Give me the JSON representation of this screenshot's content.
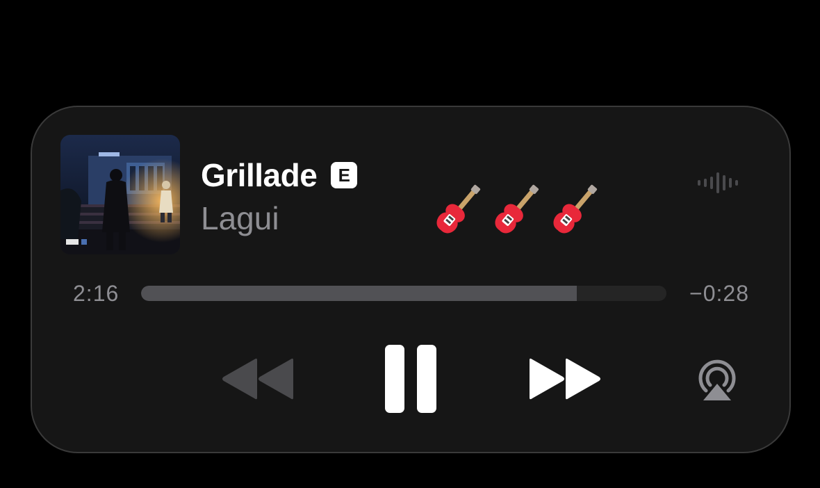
{
  "track": {
    "title": "Grillade",
    "explicit_badge": "E",
    "artist": "Lagui",
    "emoji": "🎸🎸🎸"
  },
  "playback": {
    "elapsed": "2:16",
    "remaining": "−0:28",
    "progress_fraction": 0.83
  },
  "controls": {
    "rewind_icon": "backward-icon",
    "pause_icon": "pause-icon",
    "forward_icon": "forward-icon",
    "airplay_icon": "airplay-icon",
    "waveform_icon": "waveform-icon"
  },
  "colors": {
    "background": "#000000",
    "card": "#161616",
    "primary_text": "#ffffff",
    "secondary_text": "#8e8e93",
    "progress_fill": "#515155",
    "progress_track": "#252525",
    "disabled_control": "#4a4a4d"
  }
}
